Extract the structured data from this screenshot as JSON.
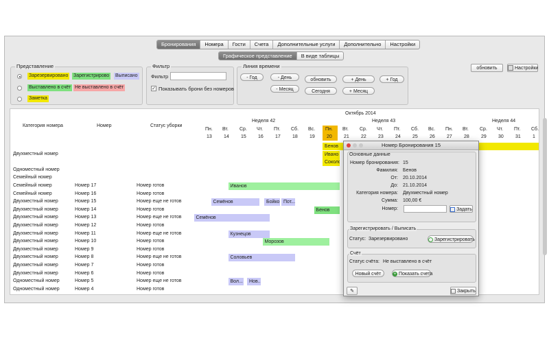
{
  "tabs": [
    {
      "label": "Бронирования",
      "active": true
    },
    {
      "label": "Номера",
      "active": false
    },
    {
      "label": "Гости",
      "active": false
    },
    {
      "label": "Счета",
      "active": false
    },
    {
      "label": "Дополнительные услуги",
      "active": false
    },
    {
      "label": "Дополнительно",
      "active": false
    },
    {
      "label": "Настройки",
      "active": false
    }
  ],
  "subtabs": [
    {
      "label": "Графическое представление",
      "active": true
    },
    {
      "label": "В виде таблицы",
      "active": false
    }
  ],
  "representation": {
    "title": "Представление",
    "items": [
      {
        "a": "Зарезервировано",
        "a_color": "#f2e800",
        "b": "Зарегистрирово",
        "b_color": "#7fe07f",
        "c": "Выписано",
        "c_color": "#c9c9f7",
        "checked": true
      },
      {
        "a": "Выставлено в счёт",
        "a_color": "#7fe07f",
        "b": "Не выставлено в счёт",
        "b_color": "#f6a6a6",
        "checked": false
      },
      {
        "a": "Заметка",
        "a_color": "#f2e800",
        "checked": false
      }
    ]
  },
  "filter": {
    "title": "Фильтр",
    "label": "Фильтр",
    "value": "",
    "checkbox_label": "Показывать брони без номеров",
    "checkbox_checked": true
  },
  "timeline": {
    "title": "Линия времени",
    "buttons": {
      "minus_year": "- Год",
      "minus_day": "- День",
      "minus_month": "- Месяц",
      "refresh": "обновить",
      "today": "Сегодня",
      "plus_day": "+ День",
      "plus_year": "+ Год",
      "plus_month": "+ Месяц"
    }
  },
  "top_right": {
    "refresh": "обновить",
    "settings": "Настройки"
  },
  "grid": {
    "month": "Октябрь 2014",
    "weeks": [
      "Неделя 42",
      "Неделя 43",
      "Неделя 44"
    ],
    "col_headers": [
      "Категория номера",
      "Номер",
      "Статус уборки"
    ],
    "days": [
      {
        "dow": "Пн.",
        "num": "13"
      },
      {
        "dow": "Вт.",
        "num": "14"
      },
      {
        "dow": "Ср.",
        "num": "15"
      },
      {
        "dow": "Чт.",
        "num": "16"
      },
      {
        "dow": "Пт.",
        "num": "17"
      },
      {
        "dow": "Сб.",
        "num": "18"
      },
      {
        "dow": "Вс.",
        "num": "19"
      },
      {
        "dow": "Пн.",
        "num": "20",
        "today": true
      },
      {
        "dow": "Вт.",
        "num": "21"
      },
      {
        "dow": "Ср.",
        "num": "22"
      },
      {
        "dow": "Чт.",
        "num": "23"
      },
      {
        "dow": "Пт.",
        "num": "24"
      },
      {
        "dow": "Сб.",
        "num": "25"
      },
      {
        "dow": "Вс.",
        "num": "26"
      },
      {
        "dow": "Пн.",
        "num": "27"
      },
      {
        "dow": "Вт.",
        "num": "28"
      },
      {
        "dow": "Ср.",
        "num": "29"
      },
      {
        "dow": "Чт.",
        "num": "30"
      },
      {
        "dow": "Пт.",
        "num": "31"
      },
      {
        "dow": "Сб.",
        "num": "1"
      }
    ],
    "rows": [
      {
        "cat": "",
        "room": "",
        "status": ""
      },
      {
        "cat": "Двухместный номер",
        "room": "",
        "status": ""
      },
      {
        "cat": "",
        "room": "",
        "status": ""
      },
      {
        "cat": "Одноместный номер",
        "room": "",
        "status": ""
      },
      {
        "cat": "Семейный номер",
        "room": "",
        "status": ""
      },
      {
        "cat": "Семейный номер",
        "room": "Номер 17",
        "status": "Номер готов"
      },
      {
        "cat": "Семейный номер",
        "room": "Номер 16",
        "status": "Номер готов"
      },
      {
        "cat": "Двухместный номер",
        "room": "Номер 15",
        "status": "Номер еще не готов"
      },
      {
        "cat": "Двухместный номер",
        "room": "Номер 14",
        "status": "Номер готов"
      },
      {
        "cat": "Двухместный номер",
        "room": "Номер 13",
        "status": "Номер еще не готов"
      },
      {
        "cat": "Двухместный номер",
        "room": "Номер 12",
        "status": "Номер готов"
      },
      {
        "cat": "Двухместный номер",
        "room": "Номер 11",
        "status": "Номер еще не готов"
      },
      {
        "cat": "Двухместный номер",
        "room": "Номер 10",
        "status": "Номер готов"
      },
      {
        "cat": "Двухместный номер",
        "room": "Номер 9",
        "status": "Номер готов"
      },
      {
        "cat": "Двухместный номер",
        "room": "Номер 8",
        "status": "Номер еще не готов"
      },
      {
        "cat": "Двухместный номер",
        "room": "Номер 7",
        "status": "Номер готов"
      },
      {
        "cat": "Двухместный номер",
        "room": "Номер 6",
        "status": "Номер готов"
      },
      {
        "cat": "Одноместный номер",
        "room": "Номер 5",
        "status": "Номер еще не готов"
      },
      {
        "cat": "Одноместный номер",
        "room": "Номер 4",
        "status": "Номер готов"
      }
    ],
    "bookings": [
      {
        "row": 0,
        "start": 7,
        "end": 20,
        "label": "Бенов",
        "color": "#f2e800"
      },
      {
        "row": 1,
        "start": 7,
        "end": 8,
        "label": "Ивано",
        "color": "#f2e800"
      },
      {
        "row": 2,
        "start": 7,
        "end": 8,
        "label": "Соколо",
        "color": "#f2e800"
      },
      {
        "row": 5,
        "start": 1.5,
        "end": 8,
        "label": "Иванов",
        "color": "#9ef09e"
      },
      {
        "row": 7,
        "start": 0.5,
        "end": 3.3,
        "label": "Семёнов",
        "color": "#c9c9f7"
      },
      {
        "row": 7,
        "start": 3.6,
        "end": 4.5,
        "label": "Бойко",
        "color": "#c9c9f7"
      },
      {
        "row": 7,
        "start": 4.6,
        "end": 5.4,
        "label": "Пот...",
        "color": "#c9c9f7"
      },
      {
        "row": 8,
        "start": 6.5,
        "end": 8,
        "label": "Бенов",
        "color": "#7fe07f"
      },
      {
        "row": 9,
        "start": -0.5,
        "end": 3.9,
        "label": "Семёнов",
        "color": "#c9c9f7"
      },
      {
        "row": 11,
        "start": 1.5,
        "end": 3.9,
        "label": "Кузнецов",
        "color": "#c9c9f7"
      },
      {
        "row": 12,
        "start": 3.5,
        "end": 7.4,
        "label": "Морозов",
        "color": "#9ef09e"
      },
      {
        "row": 14,
        "start": 1.5,
        "end": 5.4,
        "label": "Соловьев",
        "color": "#c9c9f7"
      },
      {
        "row": 17,
        "start": 1.5,
        "end": 2.4,
        "label": "Вол...",
        "color": "#c9c9f7"
      },
      {
        "row": 17,
        "start": 2.6,
        "end": 3.4,
        "label": "Нов...",
        "color": "#c9c9f7"
      }
    ]
  },
  "dialog": {
    "title": "Номер Бронирования 15",
    "main_section": "Основные данные",
    "fields": [
      {
        "label": "Номер бронирования:",
        "value": "15"
      },
      {
        "label": "Фамилия:",
        "value": "Бенов"
      },
      {
        "label": "От:",
        "value": "20.10.2014"
      },
      {
        "label": "До:",
        "value": "21.10.2014"
      },
      {
        "label": "Категория номера:",
        "value": "Двухместный номер"
      },
      {
        "label": "Сумма:",
        "value": "100,00 €"
      }
    ],
    "room_label": "Номер:",
    "room_value": "",
    "set_button": "Задать",
    "checkin_section": "Зарегистрировать / Выписать",
    "status_label": "Статус:",
    "status_value": "Зарезервировано",
    "register_button": "Зарегистрировать",
    "invoice_section": "Счёт",
    "invoice_status_label": "Статус счёта:",
    "invoice_status_value": "Не выставлено в счёт",
    "new_invoice_button": "Новый счёт",
    "show_invoice_button": "Показать счета",
    "close_button": "Закрыть"
  }
}
